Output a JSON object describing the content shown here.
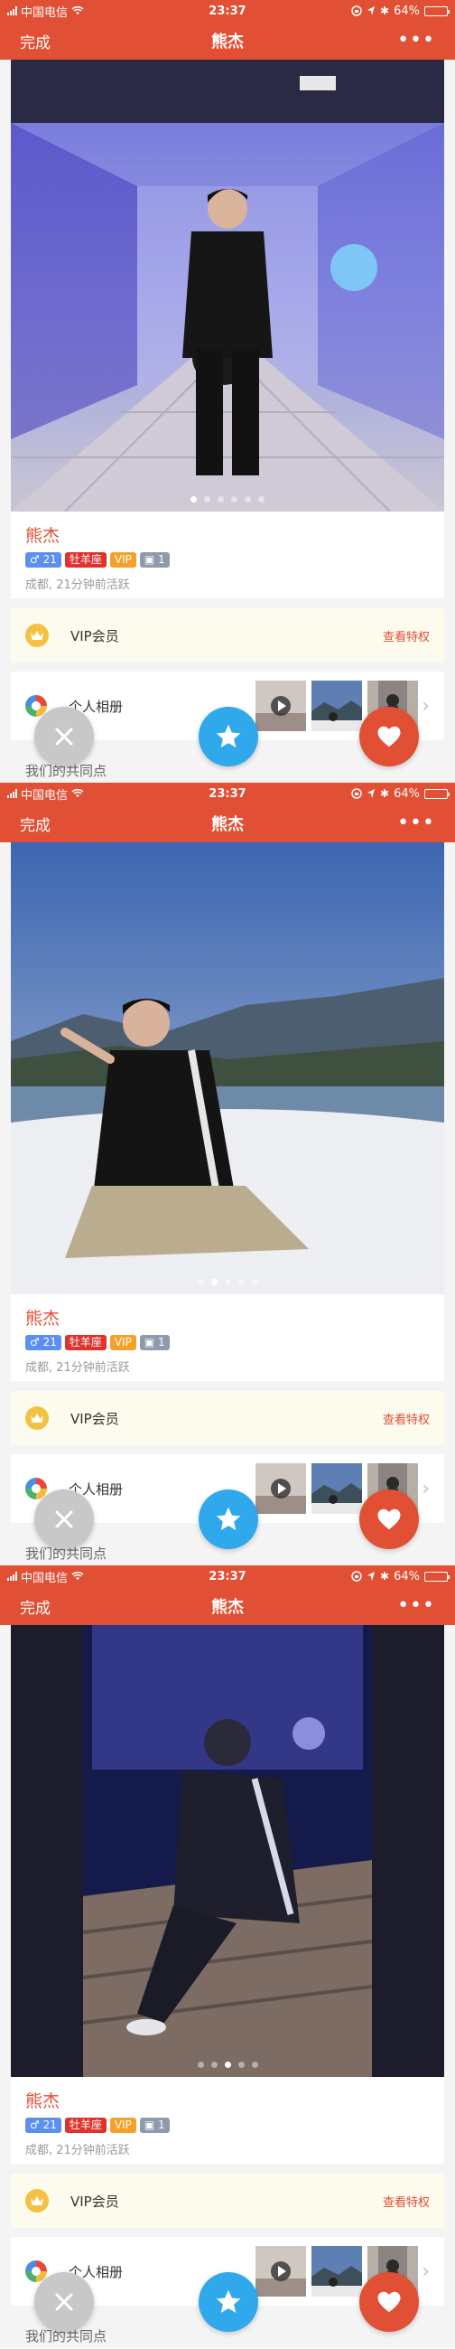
{
  "status": {
    "carrier": "中国电信",
    "time": "23:37",
    "battery": "64%",
    "battery_level": 0.64
  },
  "nav": {
    "done": "完成",
    "title": "熊杰",
    "more": "•••"
  },
  "profile": {
    "name": "熊杰",
    "badges": {
      "gender": "♂ 21",
      "zodiac": "牡羊座",
      "vip": "VIP",
      "level": "▣ 1"
    },
    "meta": "成都, 21分钟前活跃"
  },
  "vip_row": {
    "label": "VIP会员",
    "link": "查看特权"
  },
  "album_row": {
    "label": "个人相册",
    "chevron": "›"
  },
  "common_label": "我们的共同点",
  "screens": [
    {
      "photo": "glass-hallway",
      "dot_count": 6,
      "active_dot": 0
    },
    {
      "photo": "mountain-view",
      "dot_count": 5,
      "active_dot": 1
    },
    {
      "photo": "night-bench",
      "dot_count": 5,
      "active_dot": 2
    }
  ],
  "colors": {
    "brand": "#e14f34",
    "star": "#2fa8ec",
    "pass": "#c8c8c8",
    "vip_bg": "#fdfaee"
  },
  "icons": {
    "pass": "close-icon",
    "star": "star-icon",
    "like": "heart-icon",
    "vip": "crown-icon",
    "album": "album-icon"
  }
}
